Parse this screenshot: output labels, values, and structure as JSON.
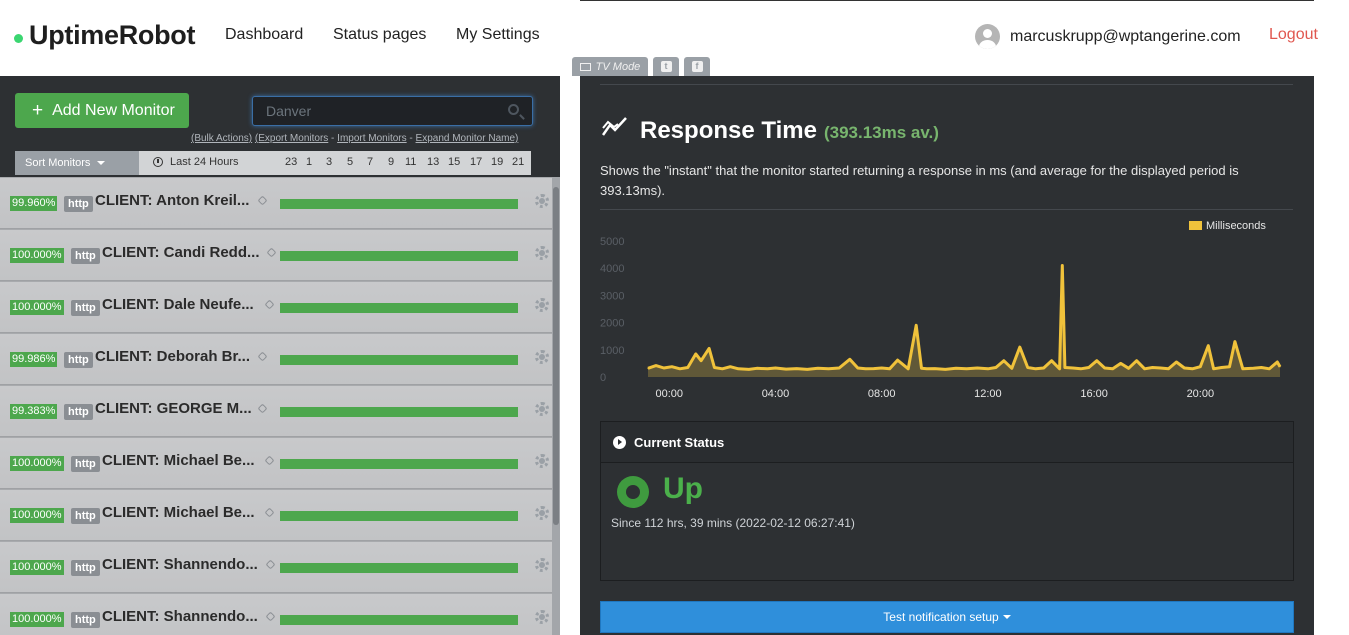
{
  "nav": {
    "logo": "UptimeRobot",
    "links": [
      "Dashboard",
      "Status pages",
      "My Settings"
    ],
    "user_email": "marcuskrupp@wptangerine.com",
    "logout": "Logout"
  },
  "tabs": {
    "tv_mode": "TV Mode",
    "twitter_glyph": "t",
    "facebook_glyph": "f"
  },
  "left": {
    "add_button": "Add New Monitor",
    "search_value": "Danver",
    "bulk_links": [
      "(Bulk Actions)",
      "(Export Monitors",
      "Import Monitors",
      "Expand Monitor Name)"
    ],
    "sort_label": "Sort Monitors",
    "range_label": "Last 24 Hours",
    "hour_ticks": [
      "23",
      "1",
      "3",
      "5",
      "7",
      "9",
      "11",
      "13",
      "15",
      "17",
      "19",
      "21"
    ],
    "monitors": [
      {
        "uptime": "99.960%",
        "type": "http",
        "name": "CLIENT: Anton Kreil..."
      },
      {
        "uptime": "100.000%",
        "type": "http",
        "name": "CLIENT: Candi Redd..."
      },
      {
        "uptime": "100.000%",
        "type": "http",
        "name": "CLIENT: Dale Neufe..."
      },
      {
        "uptime": "99.986%",
        "type": "http",
        "name": "CLIENT: Deborah Br..."
      },
      {
        "uptime": "99.383%",
        "type": "http",
        "name": "CLIENT: GEORGE M..."
      },
      {
        "uptime": "100.000%",
        "type": "http",
        "name": "CLIENT: Michael Be..."
      },
      {
        "uptime": "100.000%",
        "type": "http",
        "name": "CLIENT: Michael Be..."
      },
      {
        "uptime": "100.000%",
        "type": "http",
        "name": "CLIENT: Shannendo..."
      },
      {
        "uptime": "100.000%",
        "type": "http",
        "name": "CLIENT: Shannendo..."
      }
    ]
  },
  "right": {
    "title": "Response Time",
    "average": "(393.13ms av.)",
    "description": "Shows the \"instant\" that the monitor started returning a response in ms (and average for the displayed period is 393.13ms).",
    "current_status_title": "Current Status",
    "status": "Up",
    "since": "Since 112 hrs, 39 mins (2022-02-12 06:27:41)",
    "test_button": "Test notification setup"
  },
  "chart_data": {
    "type": "area",
    "legend": [
      "Milliseconds"
    ],
    "legend_position": "top-right",
    "color": "#f0c23b",
    "ylim": [
      0,
      5000
    ],
    "yticks": [
      "0",
      "1000",
      "2000",
      "3000",
      "4000",
      "5000"
    ],
    "xticks": [
      "00:00",
      "04:00",
      "08:00",
      "12:00",
      "16:00",
      "20:00"
    ],
    "xlim": [
      -0.8,
      23.0
    ],
    "series": [
      {
        "name": "Milliseconds",
        "x": [
          -0.8,
          -0.5,
          -0.2,
          0.1,
          0.4,
          0.7,
          1.0,
          1.2,
          1.5,
          1.7,
          2.0,
          2.3,
          2.6,
          3.0,
          3.3,
          3.7,
          4.0,
          4.4,
          4.8,
          5.2,
          5.6,
          6.0,
          6.4,
          6.8,
          7.1,
          7.4,
          7.7,
          8.0,
          8.3,
          8.6,
          9.0,
          9.3,
          9.5,
          9.7,
          10.0,
          10.4,
          10.8,
          11.2,
          11.6,
          12.0,
          12.3,
          12.6,
          12.9,
          13.2,
          13.5,
          13.8,
          14.1,
          14.4,
          14.7,
          14.8,
          14.9,
          15.2,
          15.5,
          15.8,
          16.1,
          16.4,
          16.7,
          17.0,
          17.3,
          17.6,
          17.9,
          18.2,
          18.5,
          18.8,
          19.1,
          19.4,
          19.7,
          20.0,
          20.3,
          20.5,
          20.8,
          21.1,
          21.3,
          21.6,
          22.0,
          22.3,
          22.6,
          22.9,
          23.0
        ],
        "values": [
          320,
          420,
          330,
          380,
          300,
          350,
          850,
          600,
          1050,
          350,
          300,
          380,
          300,
          280,
          320,
          300,
          330,
          290,
          310,
          280,
          320,
          300,
          330,
          650,
          330,
          300,
          310,
          330,
          300,
          620,
          300,
          1900,
          320,
          300,
          310,
          280,
          320,
          300,
          330,
          300,
          350,
          600,
          320,
          1100,
          350,
          300,
          330,
          600,
          300,
          4100,
          350,
          330,
          300,
          350,
          600,
          330,
          300,
          500,
          320,
          600,
          300,
          350,
          330,
          300,
          550,
          330,
          300,
          380,
          1150,
          300,
          350,
          380,
          1300,
          300,
          320,
          350,
          300,
          550,
          380
        ]
      }
    ]
  }
}
